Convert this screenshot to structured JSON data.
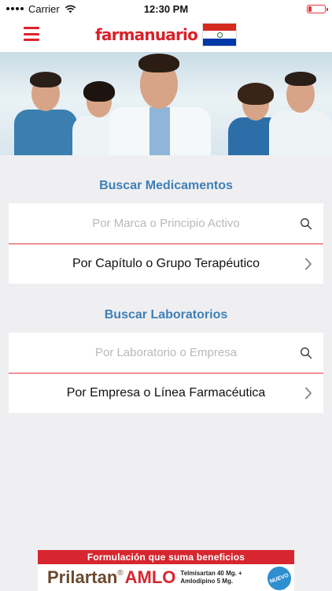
{
  "status_bar": {
    "carrier": "Carrier",
    "time": "12:30 PM",
    "battery_level": 0.18
  },
  "header": {
    "logo": "farmanuario"
  },
  "medicamentos": {
    "title": "Buscar Medicamentos",
    "search_placeholder": "Por Marca o Principio Activo",
    "browse_label": "Por Capítulo o Grupo Terapéutico"
  },
  "laboratorios": {
    "title": "Buscar Laboratorios",
    "search_placeholder": "Por Laboratorio o Empresa",
    "browse_label": "Por Empresa o Línea Farmacéutica"
  },
  "ad": {
    "tagline": "Formulación que suma beneficios",
    "brand_part1": "Prilartan",
    "brand_mark": "®",
    "brand_part2": "AMLO",
    "dose_line1": "Telmisartan 40 Mg. +",
    "dose_line2": "Amlodipino 5 Mg.",
    "badge": "NUEVO"
  },
  "colors": {
    "accent_red": "#e0222b",
    "section_blue": "#3f7fb6",
    "background": "#efeff2"
  }
}
